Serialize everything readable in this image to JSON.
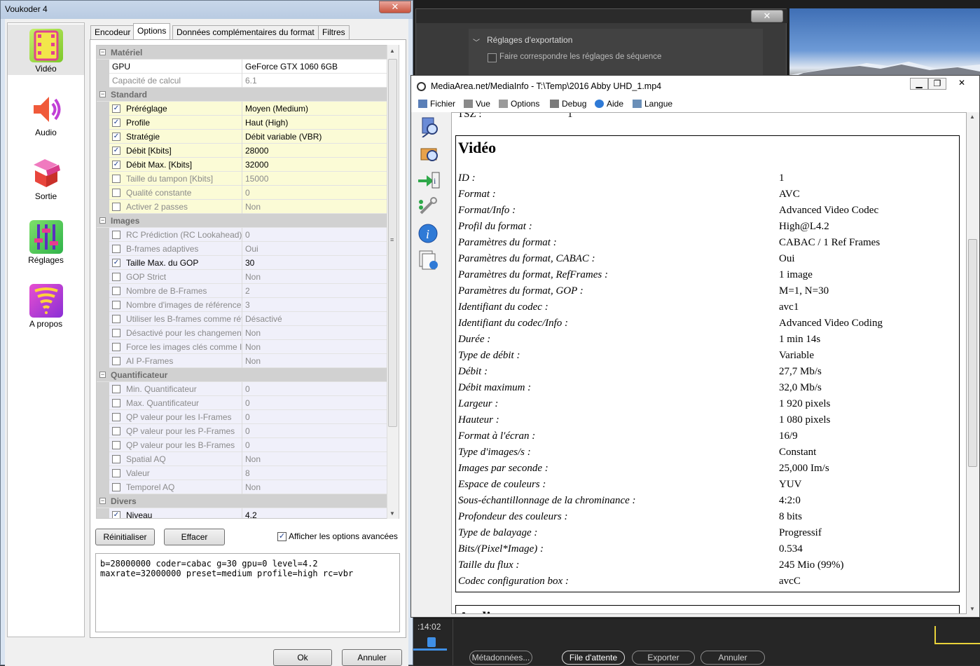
{
  "premiere": {
    "export_heading": "Réglages d'exportation",
    "match_sequence": "Faire correspondre les réglages de séquence",
    "timecode": ":14:02",
    "buttons": {
      "metadata": "Métadonnées...",
      "queue": "File d'attente",
      "export": "Exporter",
      "cancel": "Annuler"
    },
    "close_glyph": "✕"
  },
  "voukoder": {
    "title": "Voukoder 4",
    "close_glyph": "✕",
    "nav": [
      {
        "label": "Vidéo",
        "icon": "film-icon",
        "color": "#a6e04a"
      },
      {
        "label": "Audio",
        "icon": "speaker-icon",
        "color": "#e8453c"
      },
      {
        "label": "Sortie",
        "icon": "box-icon",
        "color": "#e8453c"
      },
      {
        "label": "Réglages",
        "icon": "sliders-icon",
        "color": "#4fc94a"
      },
      {
        "label": "A propos",
        "icon": "tornado-icon",
        "color": "#c13fd6"
      }
    ],
    "tabs": [
      "Encodeur",
      "Options",
      "Données complémentaires du format",
      "Filtres"
    ],
    "grid": {
      "categories": {
        "materiel": "Matériel",
        "standard": "Standard",
        "images": "Images",
        "quant": "Quantificateur",
        "divers": "Divers"
      },
      "materiel_rows": [
        {
          "name": "GPU",
          "value": "GeForce GTX 1060 6GB"
        },
        {
          "name": "Capacité de calcul",
          "value": "6.1"
        }
      ],
      "standard_rows": [
        {
          "name": "Préréglage",
          "value": "Moyen (Medium)",
          "checked": true
        },
        {
          "name": "Profile",
          "value": "Haut (High)",
          "checked": true
        },
        {
          "name": "Stratégie",
          "value": "Débit variable (VBR)",
          "checked": true
        },
        {
          "name": "Débit [Kbits]",
          "value": "28000",
          "checked": true
        },
        {
          "name": "Débit Max. [Kbits]",
          "value": "32000",
          "checked": true
        },
        {
          "name": "Taille du tampon [Kbits]",
          "value": "15000",
          "checked": false
        },
        {
          "name": "Qualité constante",
          "value": "0",
          "checked": false
        },
        {
          "name": "Activer 2 passes",
          "value": "Non",
          "checked": false
        }
      ],
      "images_rows": [
        {
          "name": "RC Prédiction (RC Lookahead)",
          "value": "0",
          "checked": false
        },
        {
          "name": "B-frames adaptives",
          "value": "Oui",
          "checked": false
        },
        {
          "name": "Taille Max. du GOP",
          "value": "30",
          "checked": true
        },
        {
          "name": "GOP Strict",
          "value": "Non",
          "checked": false
        },
        {
          "name": "Nombre de B-Frames",
          "value": "2",
          "checked": false
        },
        {
          "name": "Nombre d'images de référence",
          "value": "3",
          "checked": false
        },
        {
          "name": "Utiliser les B-frames comme réf",
          "value": "Désactivé",
          "checked": false
        },
        {
          "name": "Désactivé pour les changement",
          "value": "Non",
          "checked": false
        },
        {
          "name": "Force les images clés comme ID",
          "value": "Non",
          "checked": false
        },
        {
          "name": "AI P-Frames",
          "value": "Non",
          "checked": false
        }
      ],
      "quant_rows": [
        {
          "name": "Min. Quantificateur",
          "value": "0",
          "checked": false
        },
        {
          "name": "Max. Quantificateur",
          "value": "0",
          "checked": false
        },
        {
          "name": "QP valeur pour les I-Frames",
          "value": "0",
          "checked": false
        },
        {
          "name": "QP valeur pour les P-Frames",
          "value": "0",
          "checked": false
        },
        {
          "name": "QP valeur pour les B-Frames",
          "value": "0",
          "checked": false
        },
        {
          "name": "Spatial AQ",
          "value": "Non",
          "checked": false
        },
        {
          "name": "Valeur",
          "value": "8",
          "checked": false
        },
        {
          "name": "Temporel AQ",
          "value": "Non",
          "checked": false
        }
      ],
      "divers_rows": [
        {
          "name": "Niveau",
          "value": "4.2",
          "checked": true
        }
      ]
    },
    "reset_label": "Réinitialiser",
    "clear_label": "Effacer",
    "advanced_label": "Afficher les options avancées",
    "advanced_checked": true,
    "cmdline": "b=28000000 coder=cabac g=30 gpu=0 level=4.2\nmaxrate=32000000 preset=medium profile=high rc=vbr",
    "ok_label": "Ok",
    "cancel_label": "Annuler"
  },
  "mediainfo": {
    "title": "MediaArea.net/MediaInfo - T:\\Temp\\2016 Abby UHD_1.mp4",
    "menu": [
      "Fichier",
      "Vue",
      "Options",
      "Debug",
      "Aide",
      "Langue"
    ],
    "cut_top": "TSZ :",
    "section_title": "Vidéo",
    "next_section": "Audio",
    "fields": [
      {
        "k": "ID :",
        "v": "1"
      },
      {
        "k": "Format :",
        "v": "AVC"
      },
      {
        "k": "Format/Info :",
        "v": "Advanced Video Codec"
      },
      {
        "k": "Profil du format :",
        "v": "High@L4.2"
      },
      {
        "k": "Paramètres du format :",
        "v": "CABAC / 1 Ref Frames"
      },
      {
        "k": "Paramètres du format, CABAC :",
        "v": "Oui"
      },
      {
        "k": "Paramètres du format, RefFrames :",
        "v": "1 image"
      },
      {
        "k": "Paramètres du format, GOP :",
        "v": "M=1, N=30"
      },
      {
        "k": "Identifiant du codec :",
        "v": "avc1"
      },
      {
        "k": "Identifiant du codec/Info :",
        "v": "Advanced Video Coding"
      },
      {
        "k": "Durée :",
        "v": "1 min 14s"
      },
      {
        "k": "Type de débit :",
        "v": "Variable"
      },
      {
        "k": "Débit :",
        "v": "27,7 Mb/s"
      },
      {
        "k": "Débit maximum :",
        "v": "32,0 Mb/s"
      },
      {
        "k": "Largeur :",
        "v": "1 920 pixels"
      },
      {
        "k": "Hauteur :",
        "v": "1 080 pixels"
      },
      {
        "k": "Format à l'écran :",
        "v": "16/9"
      },
      {
        "k": "Type d'images/s :",
        "v": "Constant"
      },
      {
        "k": "Images par seconde :",
        "v": "25,000 Im/s"
      },
      {
        "k": "Espace de couleurs :",
        "v": "YUV"
      },
      {
        "k": "Sous-échantillonnage de la chrominance :",
        "v": "4:2:0"
      },
      {
        "k": "Profondeur des couleurs :",
        "v": "8 bits"
      },
      {
        "k": "Type de balayage :",
        "v": "Progressif"
      },
      {
        "k": "Bits/(Pixel*Image) :",
        "v": "0.534"
      },
      {
        "k": "Taille du flux :",
        "v": "245 Mio (99%)"
      },
      {
        "k": "Codec configuration box :",
        "v": "avcC"
      }
    ]
  }
}
